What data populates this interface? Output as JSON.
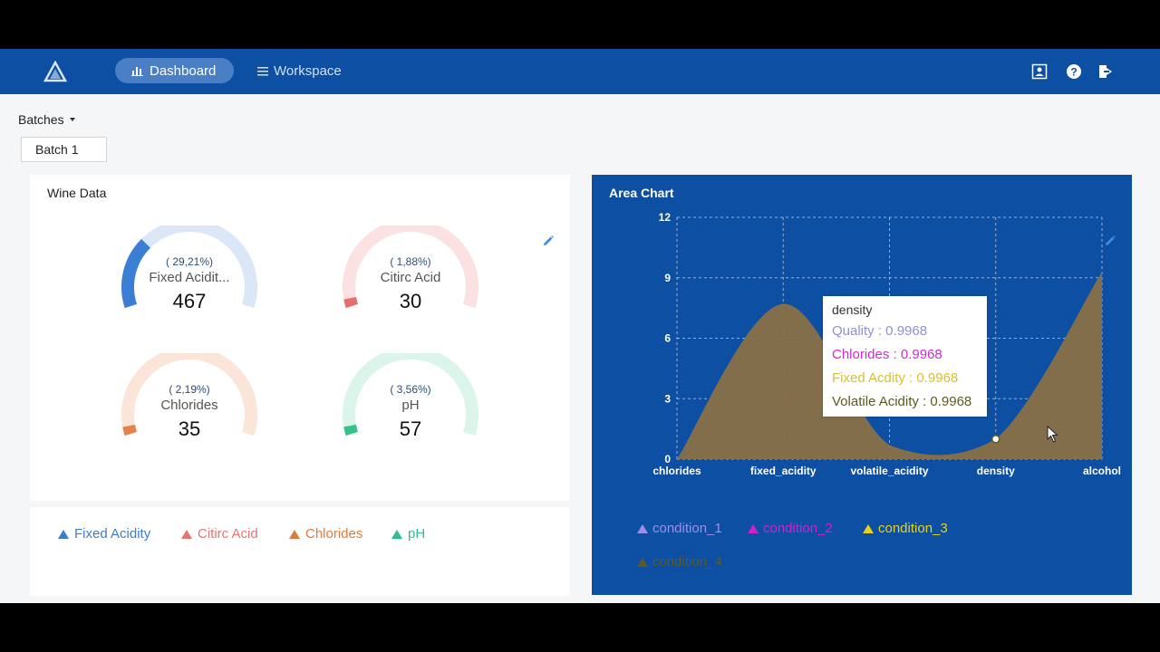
{
  "nav": {
    "dashboard_label": "Dashboard",
    "workspace_label": "Workspace",
    "icons": [
      "logo-icon",
      "user-icon",
      "help-icon",
      "logout-icon"
    ]
  },
  "batches": {
    "label": "Batches",
    "selected": "Batch 1"
  },
  "wine_card": {
    "title": "Wine Data",
    "gauges": [
      {
        "name": "Fixed Acidit...",
        "percent_text": "( 29,21%)",
        "value": "467",
        "fraction": 0.2921,
        "color": "#3b7fd4",
        "track": "#dbe7f6"
      },
      {
        "name": "Citirc Acid",
        "percent_text": "( 1,88%)",
        "value": "30",
        "fraction": 0.0188,
        "color": "#e46f6f",
        "track": "#fbe1e1"
      },
      {
        "name": "Chlorides",
        "percent_text": "( 2,19%)",
        "value": "35",
        "fraction": 0.0219,
        "color": "#e3824a",
        "track": "#fbe4d8"
      },
      {
        "name": "pH",
        "percent_text": "( 3,56%)",
        "value": "57",
        "fraction": 0.0356,
        "color": "#35c28b",
        "track": "#dcf5ea"
      }
    ]
  },
  "wine_legend": [
    {
      "label": "Fixed Acidity",
      "color": "#3d7cc9"
    },
    {
      "label": "Citirc Acid",
      "color": "#e57373"
    },
    {
      "label": "Chlorides",
      "color": "#e07b3f"
    },
    {
      "label": "pH",
      "color": "#2fbf8a"
    }
  ],
  "area_card": {
    "title": "Area Chart",
    "tooltip": {
      "header": "density",
      "rows": [
        {
          "label": "Quality : 0.9968",
          "color": "#8f8fd6"
        },
        {
          "label": "Chlorides : 0.9968",
          "color": "#d12ad1"
        },
        {
          "label": "Fixed Acdity : 0.9968",
          "color": "#d4c22e"
        },
        {
          "label": "Volatile Acidity : 0.9968",
          "color": "#5e5a1e"
        }
      ]
    },
    "legend": [
      {
        "label": "condition_1",
        "color": "#9c90e6"
      },
      {
        "label": "condition_2",
        "color": "#d020d0"
      },
      {
        "label": "condition_3",
        "color": "#e6d21e"
      },
      {
        "label": "condition_4",
        "color": "#5f5a24"
      }
    ]
  },
  "chart_data": {
    "type": "area",
    "categories": [
      "chlorides",
      "fixed_acidity",
      "volatile_acidity",
      "density",
      "alcohol"
    ],
    "series": [
      {
        "name": "condition_4",
        "values": [
          0.0,
          7.7,
          0.7,
          0.9968,
          9.3
        ],
        "color": "#8a7048"
      }
    ],
    "ylim": [
      0,
      12
    ],
    "yticks": [
      "0",
      "3",
      "6",
      "9",
      "12"
    ],
    "grid": true,
    "legend_position": "bottom",
    "highlight_category": "density"
  }
}
